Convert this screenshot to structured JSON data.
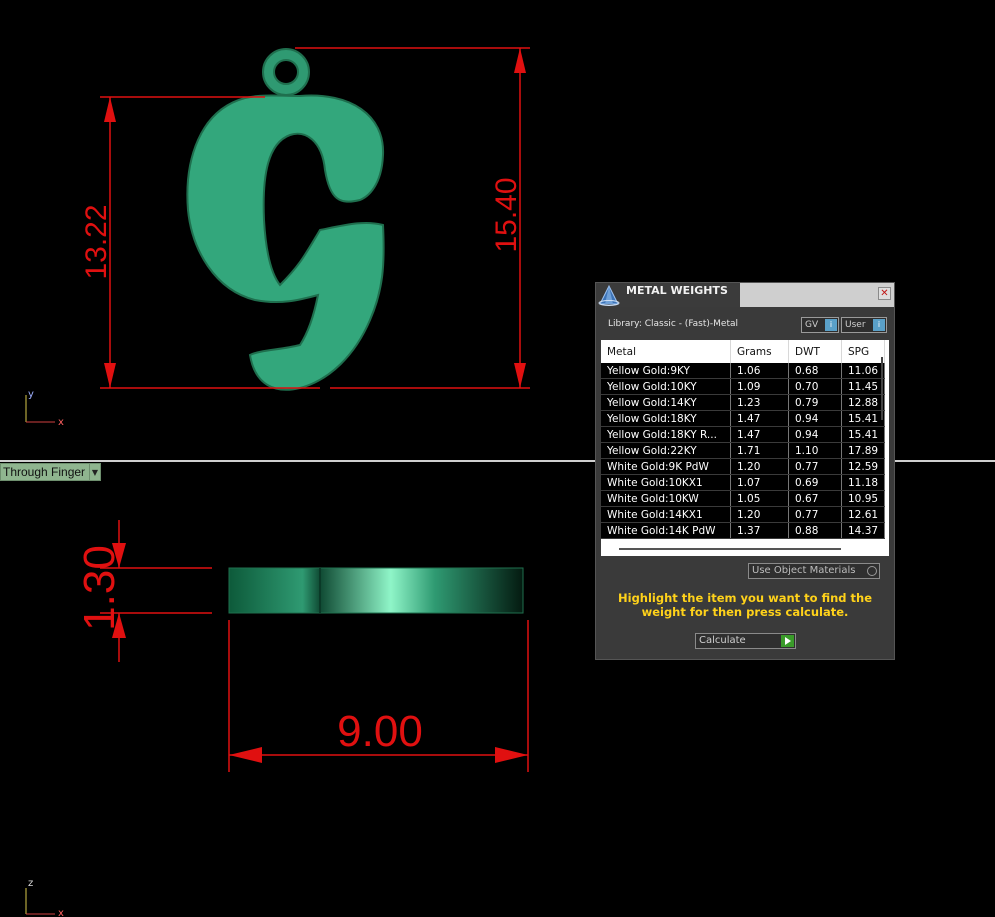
{
  "viewport_top": {
    "dim_height_body": "13.22",
    "dim_height_total": "15.40",
    "axis_y": "y",
    "axis_x": "x"
  },
  "viewport_bottom": {
    "dim_thickness": "1.30",
    "dim_width": "9.00",
    "axis_z": "z",
    "axis_x": "x"
  },
  "view_dropdown": {
    "label": "Through Finger"
  },
  "colors": {
    "dimension": "#e01010",
    "model": "#3aa57a",
    "instruction": "#ffd21a"
  },
  "metal_weights": {
    "title": "METAL WEIGHTS",
    "library_label": "Library: Classic - (Fast)-Metal",
    "units_select": "GV",
    "library_select": "User",
    "columns": [
      "Metal",
      "Grams",
      "DWT",
      "SPG"
    ],
    "rows": [
      [
        "Yellow Gold:9KY",
        "1.06",
        "0.68",
        "11.06"
      ],
      [
        "Yellow Gold:10KY",
        "1.09",
        "0.70",
        "11.45"
      ],
      [
        "Yellow Gold:14KY",
        "1.23",
        "0.79",
        "12.88"
      ],
      [
        "Yellow Gold:18KY",
        "1.47",
        "0.94",
        "15.41"
      ],
      [
        "Yellow Gold:18KY R...",
        "1.47",
        "0.94",
        "15.41"
      ],
      [
        "Yellow Gold:22KY",
        "1.71",
        "1.10",
        "17.89"
      ],
      [
        "White Gold:9K PdW",
        "1.20",
        "0.77",
        "12.59"
      ],
      [
        "White Gold:10KX1",
        "1.07",
        "0.69",
        "11.18"
      ],
      [
        "White Gold:10KW",
        "1.05",
        "0.67",
        "10.95"
      ],
      [
        "White Gold:14KX1",
        "1.20",
        "0.77",
        "12.61"
      ],
      [
        "White Gold:14K PdW",
        "1.37",
        "0.88",
        "14.37"
      ]
    ],
    "use_object_materials": "Use Object Materials",
    "instruction": "Highlight the item you want to find the weight for then press calculate.",
    "calculate_label": "Calculate"
  }
}
